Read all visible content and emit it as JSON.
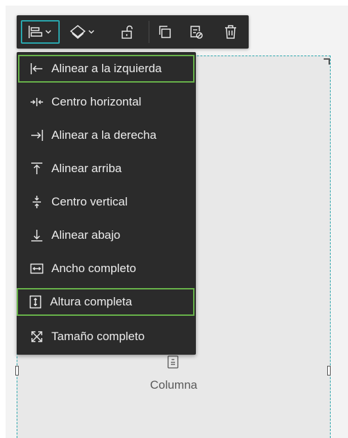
{
  "colors": {
    "toolbar_bg": "#2b2b2b",
    "menu_bg": "#2b2b2b",
    "menu_text": "#ececec",
    "selected_outline": "#2aa6ad",
    "highlight_outline": "#68b34a",
    "canvas_bg": "#e8e8e8"
  },
  "toolbar": {
    "buttons": [
      {
        "icon": "align-left-dropdown-icon"
      },
      {
        "icon": "layers-dropdown-icon"
      },
      {
        "icon": "unlock-icon"
      },
      {
        "icon": "duplicate-icon"
      },
      {
        "icon": "hide-icon"
      },
      {
        "icon": "trash-icon"
      }
    ]
  },
  "menu": {
    "items": [
      {
        "label": "Alinear a la izquierda",
        "icon": "align-left-icon"
      },
      {
        "label": "Centro horizontal",
        "icon": "center-horizontal-icon"
      },
      {
        "label": "Alinear a la derecha",
        "icon": "align-right-icon"
      },
      {
        "label": "Alinear arriba",
        "icon": "align-top-icon"
      },
      {
        "label": "Centro vertical",
        "icon": "center-vertical-icon"
      },
      {
        "label": "Alinear abajo",
        "icon": "align-bottom-icon"
      },
      {
        "label": "Ancho completo",
        "icon": "full-width-icon"
      },
      {
        "label": "Altura completa",
        "icon": "full-height-icon"
      },
      {
        "label": "Tamaño completo",
        "icon": "full-size-icon"
      }
    ]
  },
  "widget": {
    "label": "Columna",
    "icon": "column-icon"
  }
}
